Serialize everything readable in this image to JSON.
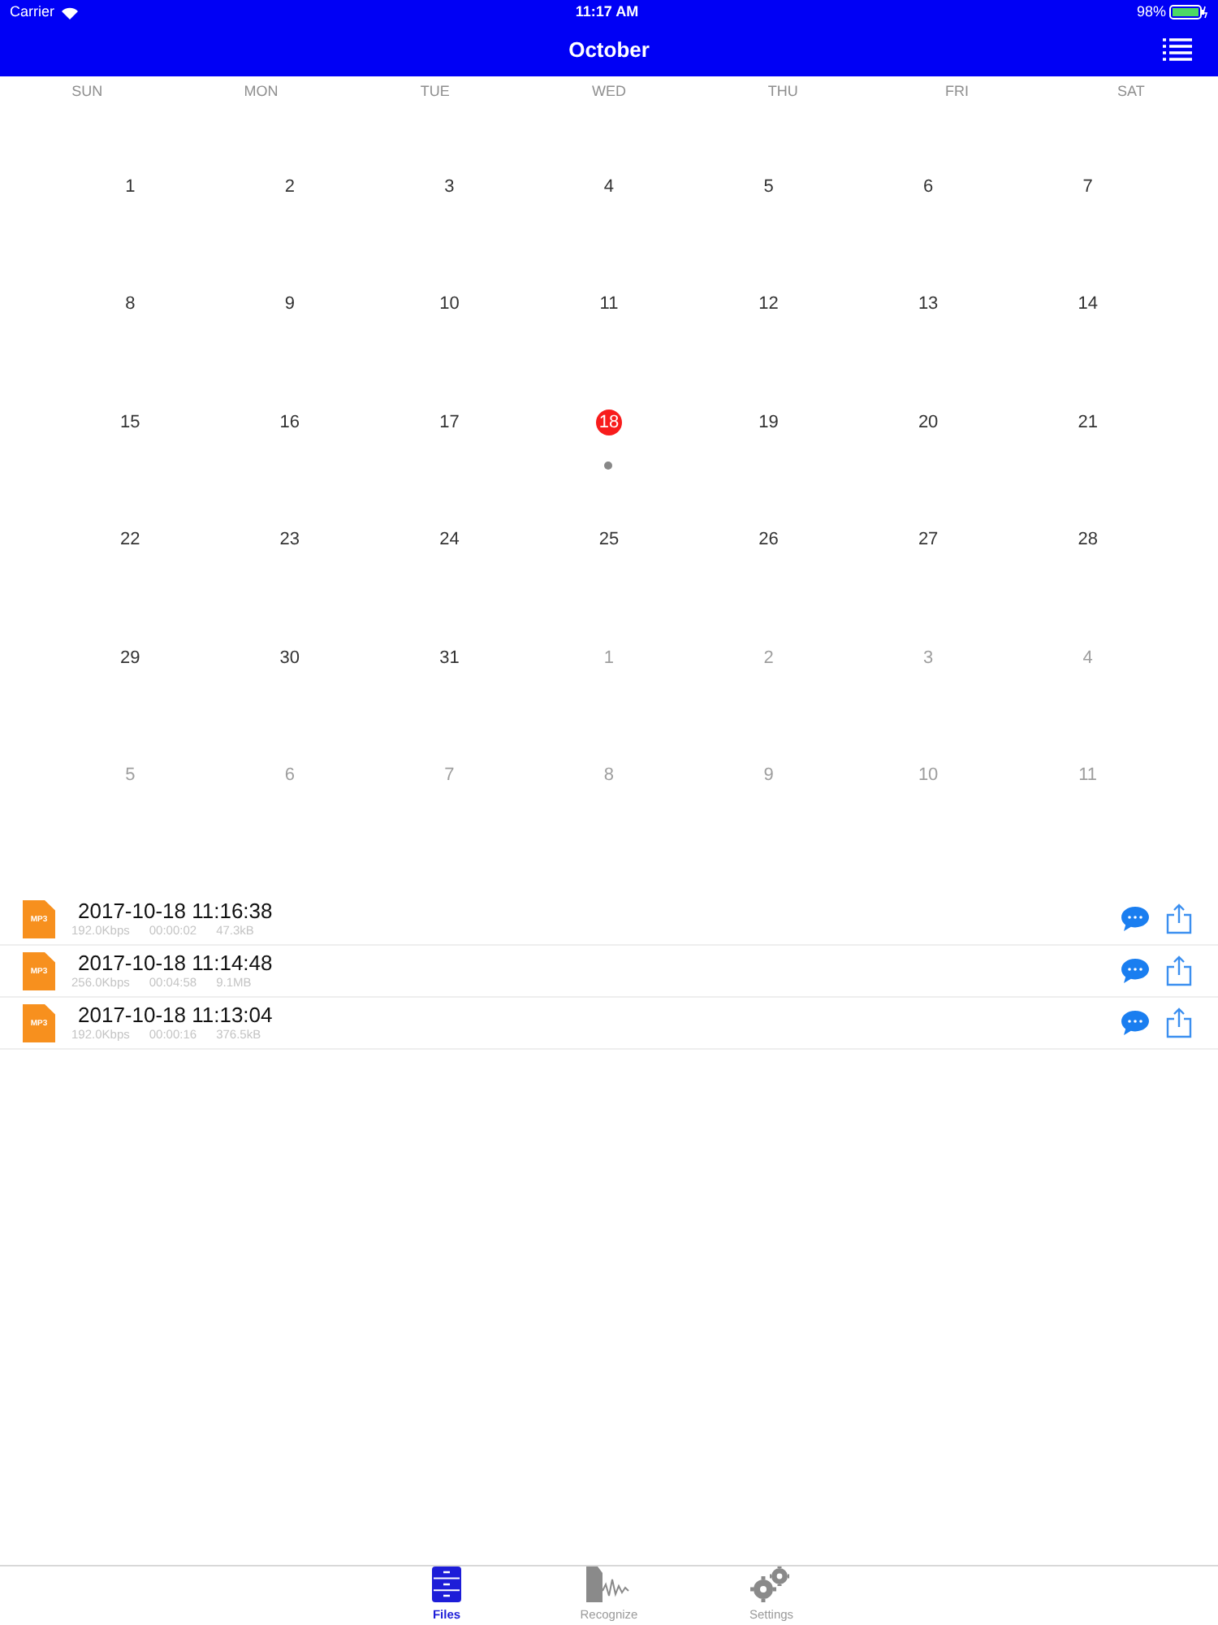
{
  "status_bar": {
    "carrier": "Carrier",
    "time": "11:17 AM",
    "battery": "98%"
  },
  "nav": {
    "title": "October"
  },
  "weekdays": [
    "SUN",
    "MON",
    "TUE",
    "WED",
    "THU",
    "FRI",
    "SAT"
  ],
  "days": [
    {
      "label": "1",
      "outside": false,
      "selected": false,
      "has_event": false
    },
    {
      "label": "2",
      "outside": false,
      "selected": false,
      "has_event": false
    },
    {
      "label": "3",
      "outside": false,
      "selected": false,
      "has_event": false
    },
    {
      "label": "4",
      "outside": false,
      "selected": false,
      "has_event": false
    },
    {
      "label": "5",
      "outside": false,
      "selected": false,
      "has_event": false
    },
    {
      "label": "6",
      "outside": false,
      "selected": false,
      "has_event": false
    },
    {
      "label": "7",
      "outside": false,
      "selected": false,
      "has_event": false
    },
    {
      "label": "8",
      "outside": false,
      "selected": false,
      "has_event": false
    },
    {
      "label": "9",
      "outside": false,
      "selected": false,
      "has_event": false
    },
    {
      "label": "10",
      "outside": false,
      "selected": false,
      "has_event": false
    },
    {
      "label": "11",
      "outside": false,
      "selected": false,
      "has_event": false
    },
    {
      "label": "12",
      "outside": false,
      "selected": false,
      "has_event": false
    },
    {
      "label": "13",
      "outside": false,
      "selected": false,
      "has_event": false
    },
    {
      "label": "14",
      "outside": false,
      "selected": false,
      "has_event": false
    },
    {
      "label": "15",
      "outside": false,
      "selected": false,
      "has_event": false
    },
    {
      "label": "16",
      "outside": false,
      "selected": false,
      "has_event": false
    },
    {
      "label": "17",
      "outside": false,
      "selected": false,
      "has_event": false
    },
    {
      "label": "18",
      "outside": false,
      "selected": true,
      "has_event": true
    },
    {
      "label": "19",
      "outside": false,
      "selected": false,
      "has_event": false
    },
    {
      "label": "20",
      "outside": false,
      "selected": false,
      "has_event": false
    },
    {
      "label": "21",
      "outside": false,
      "selected": false,
      "has_event": false
    },
    {
      "label": "22",
      "outside": false,
      "selected": false,
      "has_event": false
    },
    {
      "label": "23",
      "outside": false,
      "selected": false,
      "has_event": false
    },
    {
      "label": "24",
      "outside": false,
      "selected": false,
      "has_event": false
    },
    {
      "label": "25",
      "outside": false,
      "selected": false,
      "has_event": false
    },
    {
      "label": "26",
      "outside": false,
      "selected": false,
      "has_event": false
    },
    {
      "label": "27",
      "outside": false,
      "selected": false,
      "has_event": false
    },
    {
      "label": "28",
      "outside": false,
      "selected": false,
      "has_event": false
    },
    {
      "label": "29",
      "outside": false,
      "selected": false,
      "has_event": false
    },
    {
      "label": "30",
      "outside": false,
      "selected": false,
      "has_event": false
    },
    {
      "label": "31",
      "outside": false,
      "selected": false,
      "has_event": false
    },
    {
      "label": "1",
      "outside": true,
      "selected": false,
      "has_event": false
    },
    {
      "label": "2",
      "outside": true,
      "selected": false,
      "has_event": false
    },
    {
      "label": "3",
      "outside": true,
      "selected": false,
      "has_event": false
    },
    {
      "label": "4",
      "outside": true,
      "selected": false,
      "has_event": false
    },
    {
      "label": "5",
      "outside": true,
      "selected": false,
      "has_event": false
    },
    {
      "label": "6",
      "outside": true,
      "selected": false,
      "has_event": false
    },
    {
      "label": "7",
      "outside": true,
      "selected": false,
      "has_event": false
    },
    {
      "label": "8",
      "outside": true,
      "selected": false,
      "has_event": false
    },
    {
      "label": "9",
      "outside": true,
      "selected": false,
      "has_event": false
    },
    {
      "label": "10",
      "outside": true,
      "selected": false,
      "has_event": false
    },
    {
      "label": "11",
      "outside": true,
      "selected": false,
      "has_event": false
    }
  ],
  "recordings": [
    {
      "title": "2017-10-18 11:16:38",
      "bitrate": "192.0Kbps",
      "duration": "00:00:02",
      "size": "47.3kB",
      "badge": "MP3"
    },
    {
      "title": "2017-10-18 11:14:48",
      "bitrate": "256.0Kbps",
      "duration": "00:04:58",
      "size": "9.1MB",
      "badge": "MP3"
    },
    {
      "title": "2017-10-18 11:13:04",
      "bitrate": "192.0Kbps",
      "duration": "00:00:16",
      "size": "376.5kB",
      "badge": "MP3"
    }
  ],
  "tabs": [
    {
      "label": "Files",
      "kind": "files",
      "selected": true
    },
    {
      "label": "Recognize",
      "kind": "recognize",
      "selected": false
    },
    {
      "label": "Settings",
      "kind": "settings",
      "selected": false
    }
  ]
}
